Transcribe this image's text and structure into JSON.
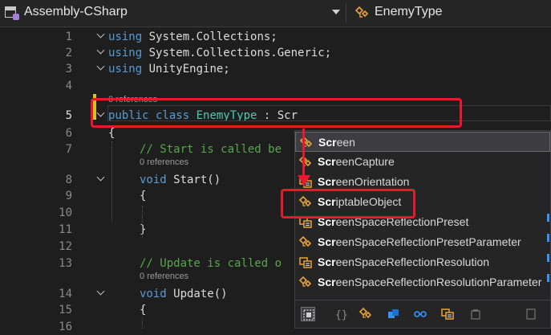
{
  "toolbar": {
    "project": "Assembly-CSharp",
    "class": "EnemyType"
  },
  "editor": {
    "lines": [
      {
        "num": "1",
        "parts": [
          [
            "kw",
            "using"
          ],
          [
            "",
            "System.Collections;"
          ]
        ]
      },
      {
        "num": "2",
        "parts": [
          [
            "kw",
            "using"
          ],
          [
            "",
            "System.Collections.Generic;"
          ]
        ]
      },
      {
        "num": "3",
        "parts": [
          [
            "kw",
            "using"
          ],
          [
            "",
            "UnityEngine;"
          ]
        ]
      },
      {
        "num": "4",
        "parts": []
      },
      {
        "num": "5",
        "parts": [
          [
            "kw",
            "public"
          ],
          [
            "kw",
            "class"
          ],
          [
            "ty",
            "EnemyType"
          ],
          [
            "",
            ":"
          ],
          [
            "",
            "Scr"
          ]
        ]
      },
      {
        "num": "6",
        "parts": [
          [
            "",
            "{"
          ]
        ]
      },
      {
        "num": "7",
        "parts": [
          [
            "cm",
            "// Start is called be"
          ]
        ]
      },
      {
        "num": "8",
        "parts": [
          [
            "kw",
            "void"
          ],
          [
            "",
            "Start()"
          ]
        ]
      },
      {
        "num": "9",
        "parts": [
          [
            "",
            "{"
          ]
        ]
      },
      {
        "num": "10",
        "parts": []
      },
      {
        "num": "11",
        "parts": [
          [
            "",
            "}"
          ]
        ]
      },
      {
        "num": "12",
        "parts": []
      },
      {
        "num": "13",
        "parts": [
          [
            "cm",
            "// Update is called o"
          ]
        ]
      },
      {
        "num": "14",
        "parts": [
          [
            "kw",
            "void"
          ],
          [
            "",
            "Update()"
          ]
        ]
      },
      {
        "num": "15",
        "parts": [
          [
            "",
            "{"
          ]
        ]
      },
      {
        "num": "16",
        "parts": []
      }
    ],
    "codelens": [
      "0 references",
      "0 references",
      "0 references"
    ]
  },
  "completion": {
    "typed": "Scr",
    "items": [
      {
        "match": "Scr",
        "rest": "een",
        "icon": "class-icon"
      },
      {
        "match": "Scr",
        "rest": "eenCapture",
        "icon": "class-icon"
      },
      {
        "match": "Scr",
        "rest": "eenOrientation",
        "icon": "enum-icon"
      },
      {
        "match": "Scr",
        "rest": "iptableObject",
        "icon": "class-icon"
      },
      {
        "match": "Scr",
        "rest": "eenSpaceReflectionPreset",
        "icon": "enum-icon"
      },
      {
        "match": "Scr",
        "rest": "eenSpaceReflectionPresetParameter",
        "icon": "class-icon"
      },
      {
        "match": "Scr",
        "rest": "eenSpaceReflectionResolution",
        "icon": "enum-icon"
      },
      {
        "match": "Scr",
        "rest": "eenSpaceReflectionResolutionParameter",
        "icon": "class-icon"
      }
    ],
    "filters": [
      "snippet-filter-icon",
      "namespace-filter-icon",
      "class-filter-icon",
      "struct-filter-icon",
      "interface-filter-icon",
      "enum-filter-icon",
      "delegate-filter-icon",
      "module-filter-icon"
    ]
  },
  "colors": {
    "annotation": "#e8192c",
    "keyword": "#569cd6",
    "type": "#4ec9b0",
    "comment": "#57a64a",
    "class_icon": "#e8a33a"
  }
}
